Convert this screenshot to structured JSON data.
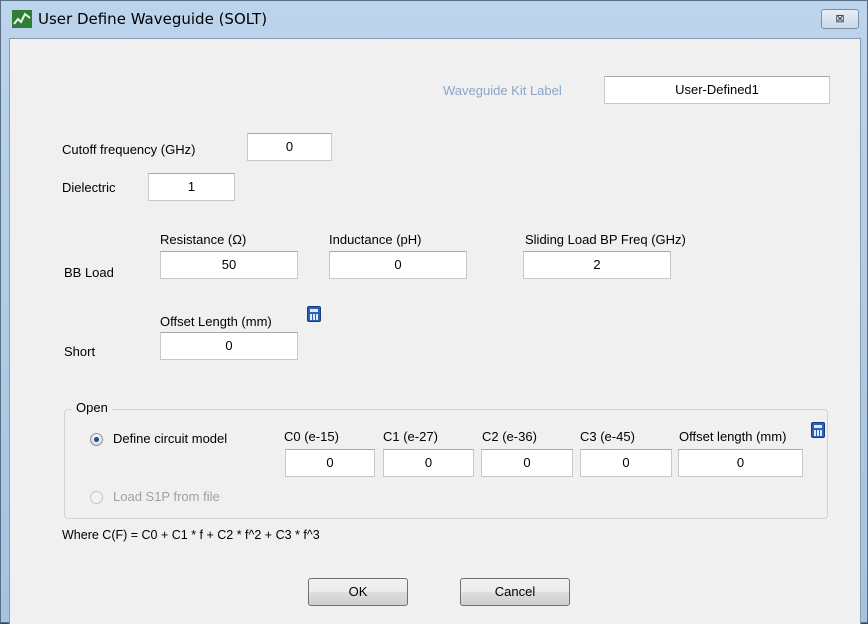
{
  "window": {
    "title": "User Define Waveguide (SOLT)",
    "close_glyph": "⊠"
  },
  "kit_label": {
    "label": "Waveguide Kit Label",
    "value": "User-Defined1"
  },
  "cutoff": {
    "label": "Cutoff frequency (GHz)",
    "value": "0"
  },
  "dielectric": {
    "label": "Dielectric",
    "value": "1"
  },
  "bb_load": {
    "label": "BB Load",
    "resistance_label": "Resistance (Ω)",
    "resistance_value": "50",
    "inductance_label": "Inductance (pH)",
    "inductance_value": "0",
    "sliding_label": "Sliding Load BP Freq (GHz)",
    "sliding_value": "2"
  },
  "short": {
    "label": "Short",
    "offset_label": "Offset Length (mm)",
    "offset_value": "0"
  },
  "open": {
    "group_title": "Open",
    "define_circuit_label": "Define circuit model",
    "define_circuit_selected": true,
    "load_s1p_label": "Load S1P from file",
    "load_s1p_enabled": false,
    "c0_label": "C0 (e-15)",
    "c0_value": "0",
    "c1_label": "C1 (e-27)",
    "c1_value": "0",
    "c2_label": "C2 (e-36)",
    "c2_value": "0",
    "c3_label": "C3 (e-45)",
    "c3_value": "0",
    "offset_label": "Offset length (mm)",
    "offset_value": "0"
  },
  "formula": "Where C(F) = C0 + C1 * f + C2 * f^2 + C3 * f^3",
  "buttons": {
    "ok": "OK",
    "cancel": "Cancel"
  },
  "icons": {
    "app": "waveguide-app-icon",
    "calculator": "calculator-icon",
    "close": "close-icon"
  },
  "colors": {
    "title_gradient": "#bcd4ec",
    "dialog_bg": "#f0f0f0",
    "dim_label": "#8aa6c9",
    "radio_dot": "#1b4f9c"
  }
}
